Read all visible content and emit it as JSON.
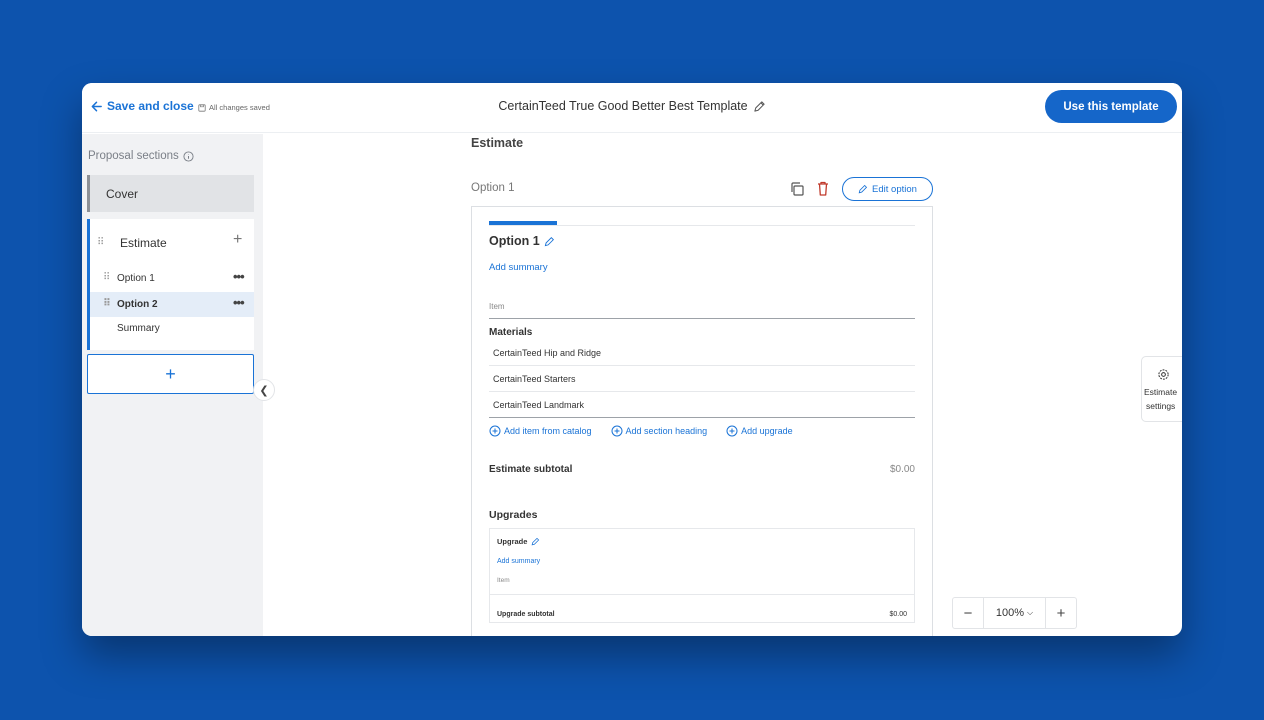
{
  "header": {
    "back_label": "Save and close",
    "saved_status": "All changes saved",
    "title": "CertainTeed True Good Better Best Template",
    "use_button": "Use this template"
  },
  "sidebar": {
    "title": "Proposal sections",
    "cover": "Cover",
    "estimate": {
      "label": "Estimate",
      "items": [
        {
          "label": "Option 1",
          "active": false
        },
        {
          "label": "Option 2",
          "active": true
        },
        {
          "label": "Summary"
        }
      ]
    }
  },
  "main": {
    "heading": "Estimate",
    "option_label": "Option 1",
    "edit_option": "Edit option",
    "card": {
      "title": "Option 1",
      "add_summary": "Add summary",
      "item_header": "Item",
      "materials_title": "Materials",
      "materials": [
        "CertainTeed Hip and Ridge",
        "CertainTeed Starters",
        "CertainTeed Landmark"
      ],
      "actions": [
        "Add item from catalog",
        "Add section heading",
        "Add upgrade"
      ],
      "subtotal_label": "Estimate subtotal",
      "subtotal_value": "$0.00",
      "upgrades_title": "Upgrades",
      "upgrade": {
        "name": "Upgrade",
        "add_summary": "Add summary",
        "item_header": "Item",
        "subtotal_label": "Upgrade subtotal",
        "subtotal_value": "$0.00"
      }
    }
  },
  "settings": {
    "line1": "Estimate",
    "line2": "settings"
  },
  "zoom": {
    "minus": "−",
    "value": "100%",
    "plus": "+"
  }
}
